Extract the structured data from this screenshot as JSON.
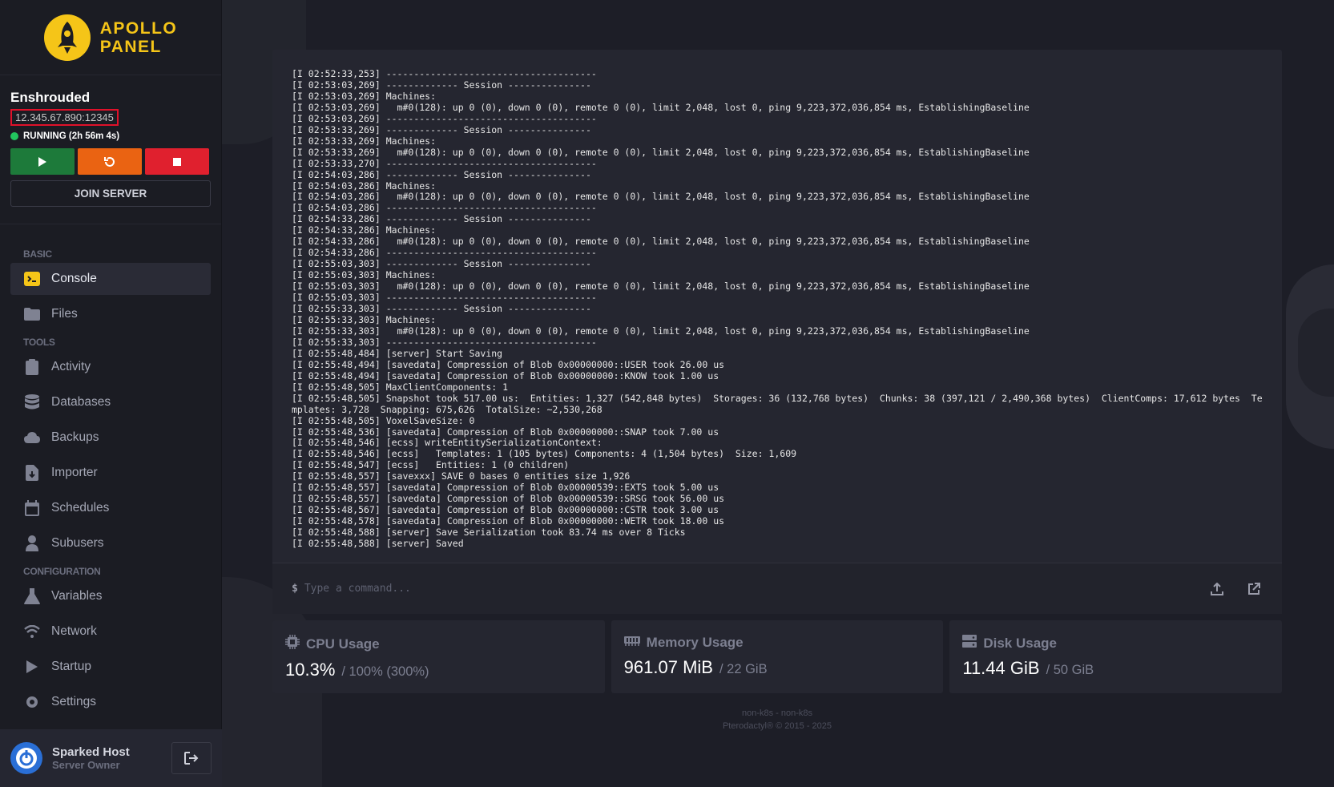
{
  "brand": {
    "line1": "APOLLO",
    "line2": "PANEL"
  },
  "server": {
    "name": "Enshrouded",
    "address": "12.345.67.890:12345",
    "status": "RUNNING (2h 56m 4s)",
    "join_label": "JOIN SERVER"
  },
  "nav": {
    "section_basic": "BASIC",
    "section_tools": "TOOLS",
    "section_config": "CONFIGURATION",
    "console": "Console",
    "files": "Files",
    "activity": "Activity",
    "databases": "Databases",
    "backups": "Backups",
    "importer": "Importer",
    "schedules": "Schedules",
    "subusers": "Subusers",
    "variables": "Variables",
    "network": "Network",
    "startup": "Startup",
    "settings": "Settings"
  },
  "user": {
    "name": "Sparked Host",
    "role": "Server Owner"
  },
  "console_lines": [
    "[I 02:52:33,253] --------------------------------------",
    "[I 02:53:03,269] ------------- Session ---------------",
    "[I 02:53:03,269] Machines:",
    "[I 02:53:03,269]   m#0(128): up 0 (0), down 0 (0), remote 0 (0), limit 2,048, lost 0, ping 9,223,372,036,854 ms, EstablishingBaseline",
    "[I 02:53:03,269] --------------------------------------",
    "[I 02:53:33,269] ------------- Session ---------------",
    "[I 02:53:33,269] Machines:",
    "[I 02:53:33,269]   m#0(128): up 0 (0), down 0 (0), remote 0 (0), limit 2,048, lost 0, ping 9,223,372,036,854 ms, EstablishingBaseline",
    "[I 02:53:33,270] --------------------------------------",
    "[I 02:54:03,286] ------------- Session ---------------",
    "[I 02:54:03,286] Machines:",
    "[I 02:54:03,286]   m#0(128): up 0 (0), down 0 (0), remote 0 (0), limit 2,048, lost 0, ping 9,223,372,036,854 ms, EstablishingBaseline",
    "[I 02:54:03,286] --------------------------------------",
    "[I 02:54:33,286] ------------- Session ---------------",
    "[I 02:54:33,286] Machines:",
    "[I 02:54:33,286]   m#0(128): up 0 (0), down 0 (0), remote 0 (0), limit 2,048, lost 0, ping 9,223,372,036,854 ms, EstablishingBaseline",
    "[I 02:54:33,286] --------------------------------------",
    "[I 02:55:03,303] ------------- Session ---------------",
    "[I 02:55:03,303] Machines:",
    "[I 02:55:03,303]   m#0(128): up 0 (0), down 0 (0), remote 0 (0), limit 2,048, lost 0, ping 9,223,372,036,854 ms, EstablishingBaseline",
    "[I 02:55:03,303] --------------------------------------",
    "[I 02:55:33,303] ------------- Session ---------------",
    "[I 02:55:33,303] Machines:",
    "[I 02:55:33,303]   m#0(128): up 0 (0), down 0 (0), remote 0 (0), limit 2,048, lost 0, ping 9,223,372,036,854 ms, EstablishingBaseline",
    "[I 02:55:33,303] --------------------------------------",
    "[I 02:55:48,484] [server] Start Saving",
    "[I 02:55:48,494] [savedata] Compression of Blob 0x00000000::USER took 26.00 us",
    "[I 02:55:48,494] [savedata] Compression of Blob 0x00000000::KNOW took 1.00 us",
    "[I 02:55:48,505] MaxClientComponents: 1",
    "[I 02:55:48,505] Snapshot took 517.00 us:  Entities: 1,327 (542,848 bytes)  Storages: 36 (132,768 bytes)  Chunks: 38 (397,121 / 2,490,368 bytes)  ClientComps: 17,612 bytes  Templates: 3,728  Snapping: 675,626  TotalSize: ~2,530,268",
    "[I 02:55:48,505] VoxelSaveSize: 0",
    "[I 02:55:48,536] [savedata] Compression of Blob 0x00000000::SNAP took 7.00 us",
    "[I 02:55:48,546] [ecss] writeEntitySerializationContext:",
    "[I 02:55:48,546] [ecss]   Templates: 1 (105 bytes) Components: 4 (1,504 bytes)  Size: 1,609",
    "[I 02:55:48,547] [ecss]   Entities: 1 (0 children)",
    "[I 02:55:48,557] [savexxx] SAVE 0 bases 0 entities size 1,926",
    "[I 02:55:48,557] [savedata] Compression of Blob 0x00000539::EXTS took 5.00 us",
    "[I 02:55:48,557] [savedata] Compression of Blob 0x00000539::SRSG took 56.00 us",
    "[I 02:55:48,567] [savedata] Compression of Blob 0x00000000::CSTR took 3.00 us",
    "[I 02:55:48,578] [savedata] Compression of Blob 0x00000000::WETR took 18.00 us",
    "[I 02:55:48,588] [server] Save Serialization took 83.74 ms over 8 Ticks",
    "[I 02:55:48,588] [server] Saved"
  ],
  "command": {
    "prompt": "$",
    "placeholder": "Type a command..."
  },
  "stats": {
    "cpu": {
      "label": "CPU Usage",
      "value": "10.3%",
      "limit": "/ 100% (300%)"
    },
    "memory": {
      "label": "Memory Usage",
      "value": "961.07 MiB",
      "limit": "/ 22 GiB"
    },
    "disk": {
      "label": "Disk Usage",
      "value": "11.44 GiB",
      "limit": "/ 50 GiB"
    }
  },
  "footer": {
    "line1": "non-k8s - non-k8s",
    "line2": "Pterodactyl® © 2015 - 2025"
  }
}
